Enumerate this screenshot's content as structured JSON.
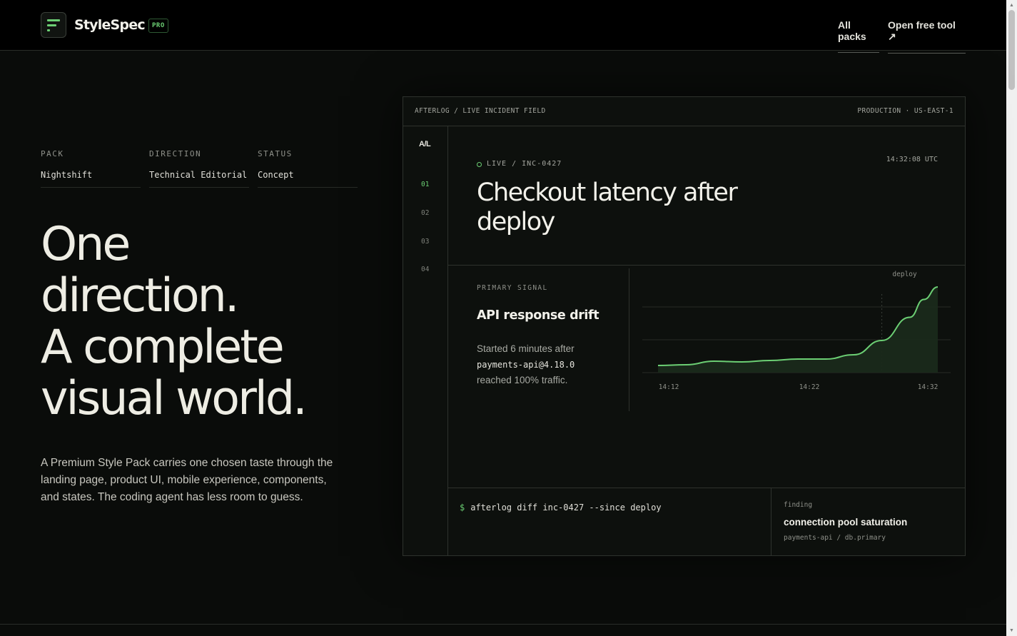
{
  "header": {
    "brand": "StyleSpec",
    "badge": "PRO",
    "nav": [
      {
        "label": "All packs"
      },
      {
        "label": "Open free tool ↗"
      }
    ]
  },
  "meta": [
    {
      "key": "PACK",
      "value": "Nightshift"
    },
    {
      "key": "DIRECTION",
      "value": "Technical Editorial"
    },
    {
      "key": "STATUS",
      "value": "Concept"
    }
  ],
  "hero": {
    "headline_lines": [
      "One",
      "direction.",
      "A complete",
      "visual world."
    ],
    "intro": "A Premium Style Pack carries one chosen taste through the landing page, product UI, mobile experience, components, and states. The coding agent has less room to guess."
  },
  "panel": {
    "breadcrumb": "AFTERLOG / LIVE INCIDENT FIELD",
    "environment": "PRODUCTION · US-EAST-1",
    "rail_logo": "A/L",
    "rail_items": [
      "01",
      "02",
      "03",
      "04"
    ],
    "live_label": "LIVE / INC-0427",
    "timestamp": "14:32:08 UTC",
    "title": "Checkout latency after deploy",
    "signal": {
      "key": "PRIMARY SIGNAL",
      "title": "API response drift",
      "body_pre": "Started 6 minutes after",
      "body_code": "payments-api@4.18.0",
      "body_post": "reached 100% traffic."
    },
    "terminal": {
      "prompt": "$",
      "command": "afterlog diff inc-0427 --since deploy"
    },
    "finding": {
      "key": "finding",
      "title": "connection pool saturation",
      "sub": "payments-api / db.primary"
    }
  },
  "chart_data": {
    "type": "area",
    "x_ticks": [
      "14:12",
      "14:22",
      "14:32"
    ],
    "annotation": "deploy",
    "annotation_x": 14.28,
    "x": [
      14.12,
      14.14,
      14.16,
      14.18,
      14.2,
      14.22,
      14.24,
      14.26,
      14.28,
      14.3,
      14.31,
      14.32
    ],
    "values": [
      0.2,
      0.22,
      0.32,
      0.3,
      0.34,
      0.38,
      0.38,
      0.5,
      0.9,
      1.55,
      2.05,
      2.4
    ],
    "ylim": [
      0,
      2.6
    ],
    "grid": true,
    "accent": "#6ccf74"
  },
  "colors": {
    "accent": "#6ccf74",
    "background": "#0a0c0a",
    "panel": "#0d100d"
  }
}
